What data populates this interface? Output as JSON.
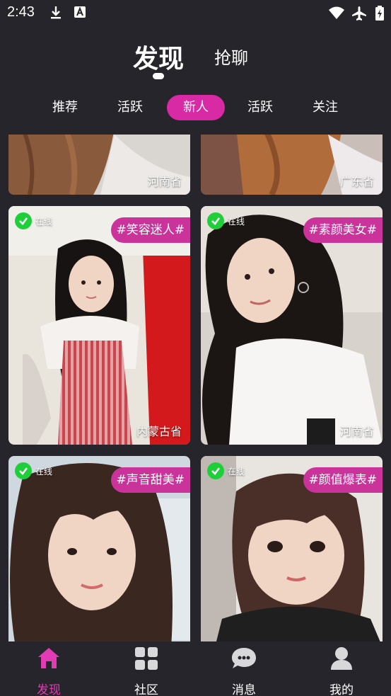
{
  "status_bar": {
    "time": "2:43"
  },
  "top_tabs": [
    {
      "label": "发现",
      "active": true
    },
    {
      "label": "抢聊",
      "active": false
    }
  ],
  "filters": [
    {
      "label": "推荐",
      "active": false
    },
    {
      "label": "活跃",
      "active": false
    },
    {
      "label": "新人",
      "active": true
    },
    {
      "label": "活跃",
      "active": false
    },
    {
      "label": "关注",
      "active": false
    }
  ],
  "cards": [
    {
      "province": "河南省",
      "online_label": "",
      "tag": ""
    },
    {
      "province": "广东省",
      "online_label": "",
      "tag": ""
    },
    {
      "province": "内蒙古省",
      "online_label": "在线",
      "tag": "#笑容迷人#"
    },
    {
      "province": "河南省",
      "online_label": "在线",
      "tag": "#素颜美女#"
    },
    {
      "province": "",
      "online_label": "在线",
      "tag": "#声音甜美#"
    },
    {
      "province": "",
      "online_label": "在线",
      "tag": "#颜值爆表#"
    }
  ],
  "bottom_nav": [
    {
      "label": "发现",
      "icon": "home-icon",
      "active": true
    },
    {
      "label": "社区",
      "icon": "grid-icon",
      "active": false
    },
    {
      "label": "消息",
      "icon": "chat-bubble-icon",
      "active": false
    },
    {
      "label": "我的",
      "icon": "person-icon",
      "active": false
    }
  ],
  "colors": {
    "background": "#26252b",
    "accent": "#d92aa5",
    "tag": "#c9339a",
    "online": "#1fcf3a",
    "nav_active": "#e23bb3"
  }
}
